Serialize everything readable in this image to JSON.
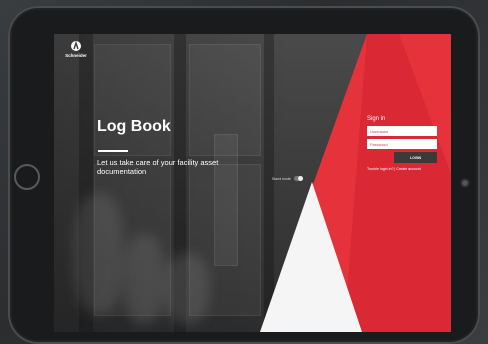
{
  "app": {
    "brand": "Schneider",
    "title": "Log Book",
    "tagline": "Let us take care of your facility asset documentation",
    "stand_mode_label": "Stand mode"
  },
  "signin": {
    "heading": "Sign in",
    "username_placeholder": "Username",
    "password_placeholder": "Password",
    "login_label": "LOGIN",
    "trouble_link": "Trouble login in? |",
    "create_link": "Create account"
  },
  "colors": {
    "accent_red": "#e5323b",
    "deep_red": "#d22030",
    "white_triangle": "#f5f5f5",
    "button_dark": "#3a3a3a"
  },
  "icons": [
    "schneider-logo-icon",
    "home-button-icon",
    "camera-icon"
  ]
}
